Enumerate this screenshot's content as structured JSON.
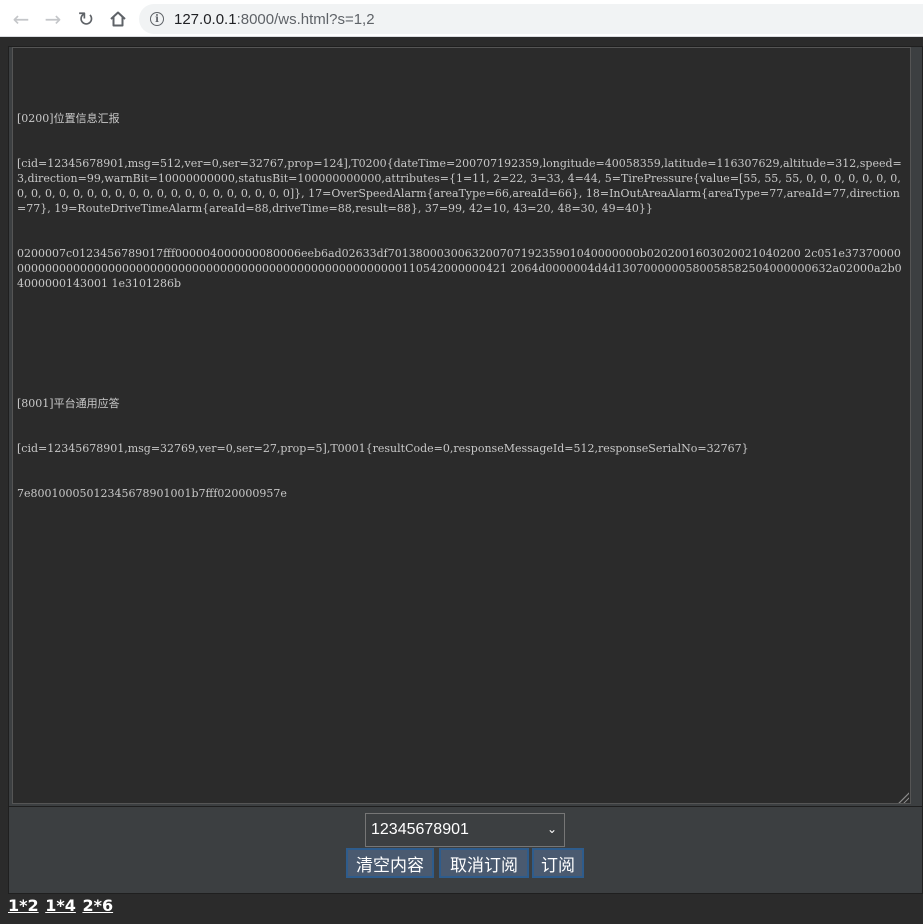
{
  "browser": {
    "url_host": "127.0.0.1",
    "url_rest": ":8000/ws.html?s=1,2"
  },
  "log": [
    {
      "title": "[0200]位置信息汇报",
      "body": "[cid=12345678901,msg=512,ver=0,ser=32767,prop=124],T0200{dateTime=200707192359,longitude=40058359,latitude=116307629,altitude=312,speed=3,direction=99,warnBit=10000000000,statusBit=100000000000,attributes={1=11, 2=22, 3=33, 4=44, 5=TirePressure{value=[55, 55, 55, 0, 0, 0, 0, 0, 0, 0, 0, 0, 0, 0, 0, 0, 0, 0, 0, 0, 0, 0, 0, 0, 0, 0, 0, 0, 0, 0]}, 17=OverSpeedAlarm{areaType=66,areaId=66}, 18=InOutAreaAlarm{areaType=77,areaId=77,direction=77}, 19=RouteDriveTimeAlarm{areaId=88,driveTime=88,result=88}, 37=99, 42=10, 43=20, 48=30, 49=40}}",
      "hex": "0200007c0123456789017fff000004000000080006eeb6ad02633df701380003006320070719235901040000000b0202001603020021040200 2c051e373700000000000000000000000000000000000000000000000000000000000110542000000421 2064d0000004d4d1307000000580058582504000000632a02000a2b04000000143001 1e3101286b"
    },
    {
      "title": "[8001]平台通用应答",
      "body": "[cid=12345678901,msg=32769,ver=0,ser=27,prop=5],T0001{resultCode=0,responseMessageId=512,responseSerialNo=32767}",
      "hex": "7e80010005012345678901001b7fff020000957e"
    }
  ],
  "controls": {
    "select_value": "12345678901",
    "clear_label": "清空内容",
    "unsubscribe_label": "取消订阅",
    "subscribe_label": "订阅"
  },
  "links": [
    "1*2",
    "1*4",
    "2*6"
  ]
}
